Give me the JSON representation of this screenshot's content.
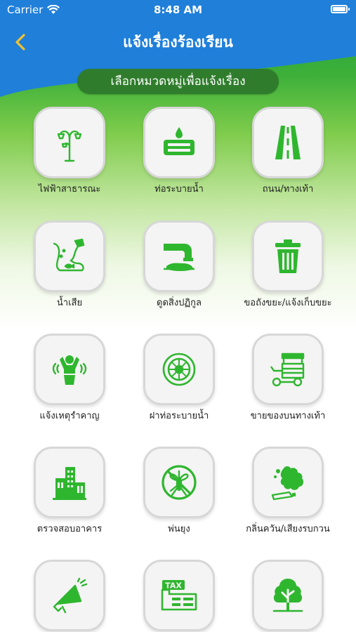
{
  "status_bar": {
    "carrier": "Carrier",
    "time": "8:48 AM"
  },
  "header": {
    "title": "แจ้งเรื่องร้องเรียน",
    "subtitle": "เลือกหมวดหมู่เพื่อแจ้งเรื่อง"
  },
  "colors": {
    "accent_green": "#2fb62f",
    "header_blue": "#1f7fd9",
    "back_arrow": "#f2c230"
  },
  "categories": [
    {
      "label": "ไฟฟ้าสาธารณะ",
      "icon": "street-lamp-icon"
    },
    {
      "label": "ท่อระบายน้ำ",
      "icon": "drain-pipe-icon"
    },
    {
      "label": "ถนน/ทางเท้า",
      "icon": "road-icon"
    },
    {
      "label": "น้ำเสีย",
      "icon": "wastewater-icon"
    },
    {
      "label": "ดูดสิ่งปฏิกูล",
      "icon": "sewage-suction-icon"
    },
    {
      "label": "ขอถังขยะ/แจ้งเก็บขยะ",
      "icon": "trash-bin-icon"
    },
    {
      "label": "แจ้งเหตุรำคาญ",
      "icon": "nuisance-icon"
    },
    {
      "label": "ฝาท่อระบายน้ำ",
      "icon": "manhole-cover-icon"
    },
    {
      "label": "ขายของบนทางเท้า",
      "icon": "street-vendor-cart-icon"
    },
    {
      "label": "ตรวจสอบอาคาร",
      "icon": "building-icon"
    },
    {
      "label": "พ่นยุง",
      "icon": "no-mosquito-icon"
    },
    {
      "label": "กลิ่นควัน/เสียงรบกวน",
      "icon": "smoke-icon"
    },
    {
      "label": "",
      "icon": "megaphone-icon"
    },
    {
      "label": "",
      "icon": "tax-icon"
    },
    {
      "label": "",
      "icon": "tree-icon"
    }
  ]
}
